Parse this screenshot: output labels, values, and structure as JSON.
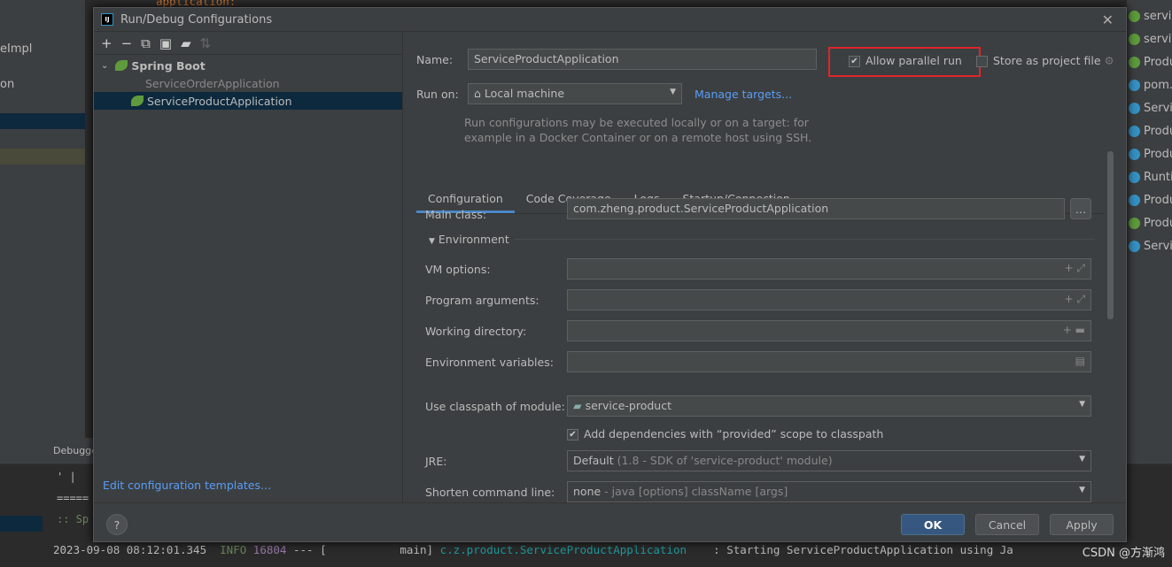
{
  "ide": {
    "editor_line": "application:",
    "left_items": [
      "eImpl",
      "on"
    ],
    "right_items": [
      {
        "label": "servic",
        "icon": "spring-boot-icon",
        "color": "#5f9b3c"
      },
      {
        "label": "servic",
        "icon": "spring-boot-icon",
        "color": "#5f9b3c"
      },
      {
        "label": "Produ",
        "icon": "interface-icon",
        "color": "#5f9b3c"
      },
      {
        "label": "pom.x",
        "icon": "maven-icon",
        "color": "#3592c4"
      },
      {
        "label": "Servic",
        "icon": "class-run-icon",
        "color": "#3592c4"
      },
      {
        "label": "Produ",
        "icon": "class-icon",
        "color": "#3592c4"
      },
      {
        "label": "Produ",
        "icon": "class-icon",
        "color": "#3592c4"
      },
      {
        "label": "Runtir",
        "icon": "class-locked-icon",
        "color": "#3592c4"
      },
      {
        "label": "Produ",
        "icon": "class-icon",
        "color": "#3592c4"
      },
      {
        "label": "Produ",
        "icon": "interface-icon",
        "color": "#5f9b3c"
      },
      {
        "label": "Servic",
        "icon": "class-run-icon",
        "color": "#3592c4"
      }
    ],
    "bottom_tab": "Debugge",
    "console_lines": [
      "' |",
      "=====",
      ":: Sp"
    ],
    "log": {
      "timestamp": "2023-09-08 08:12:01.345",
      "level": "INFO",
      "pid": "16804",
      "sep": "--- [",
      "thread": "main]",
      "logger": "c.z.product.ServiceProductApplication",
      "message": ": Starting ServiceProductApplication using Ja"
    },
    "watermark": "CSDN @方渐鸿"
  },
  "dialog": {
    "title": "Run/Debug Configurations",
    "toolbar": [
      "add-icon",
      "remove-icon",
      "copy-icon",
      "save-icon",
      "folder-add-icon",
      "sort-icon"
    ],
    "tree": {
      "group": "Spring Boot",
      "items": [
        {
          "label": "ServiceOrderApplication",
          "selected": false
        },
        {
          "label": "ServiceProductApplication",
          "selected": true
        }
      ]
    },
    "edit_templates": "Edit configuration templates...",
    "name_label": "Name:",
    "name_value": "ServiceProductApplication",
    "allow_parallel": {
      "label": "Allow parallel run",
      "checked": true
    },
    "store_project": {
      "label": "Store as project file",
      "checked": false
    },
    "run_on_label": "Run on:",
    "run_on_value": "Local machine",
    "manage_targets": "Manage targets...",
    "run_hint": [
      "Run configurations may be executed locally or on a target: for",
      "example in a Docker Container or on a remote host using SSH."
    ],
    "tabs": [
      {
        "label": "Configuration",
        "active": true
      },
      {
        "label": "Code Coverage"
      },
      {
        "label": "Logs"
      },
      {
        "label": "Startup/Connection"
      }
    ],
    "main_class_label": "Main class:",
    "main_class_value": "com.zheng.product.ServiceProductApplication",
    "environment": "Environment",
    "vm_options": "VM options:",
    "program_args": "Program arguments:",
    "working_dir": "Working directory:",
    "env_vars": "Environment variables:",
    "classpath_label": "Use classpath of module:",
    "classpath_value": "service-product",
    "add_deps": {
      "label": "Add dependencies with “provided” scope to classpath",
      "checked": true
    },
    "jre_label": "JRE:",
    "jre_value": "Default",
    "jre_hint": "(1.8 - SDK of 'service-product' module)",
    "shorten_label": "Shorten command line:",
    "shorten_value": "none",
    "shorten_hint": "- java [options] className [args]",
    "buttons": {
      "ok": "OK",
      "cancel": "Cancel",
      "apply": "Apply",
      "help": "?"
    }
  }
}
